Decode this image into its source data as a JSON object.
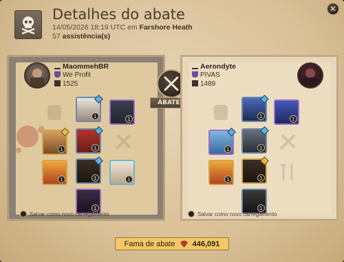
{
  "header": {
    "title": "Detalhes do abate",
    "timestamp": "14/05/2026 18:19 UTC em",
    "location": "Farshore Heath",
    "assists_count": "57",
    "assists_label": "assistência(s)",
    "close_label": "✕"
  },
  "center": {
    "kill_label": "ABATEU"
  },
  "killer": {
    "name": "MaommehBR",
    "guild": "We Profit",
    "ip": "1525",
    "save_label": "Salvar como novo carregamento"
  },
  "victim": {
    "name": "Aerondyte",
    "guild": "PIVAS",
    "ip": "1489",
    "save_label": "Salvar como novo carregamento"
  },
  "fame": {
    "label": "Fama de abate",
    "value": "446,091"
  },
  "colors": {
    "accent_gold": "#f2c766",
    "blood_red": "#b23a2a",
    "parchment": "#e8d5b4"
  }
}
